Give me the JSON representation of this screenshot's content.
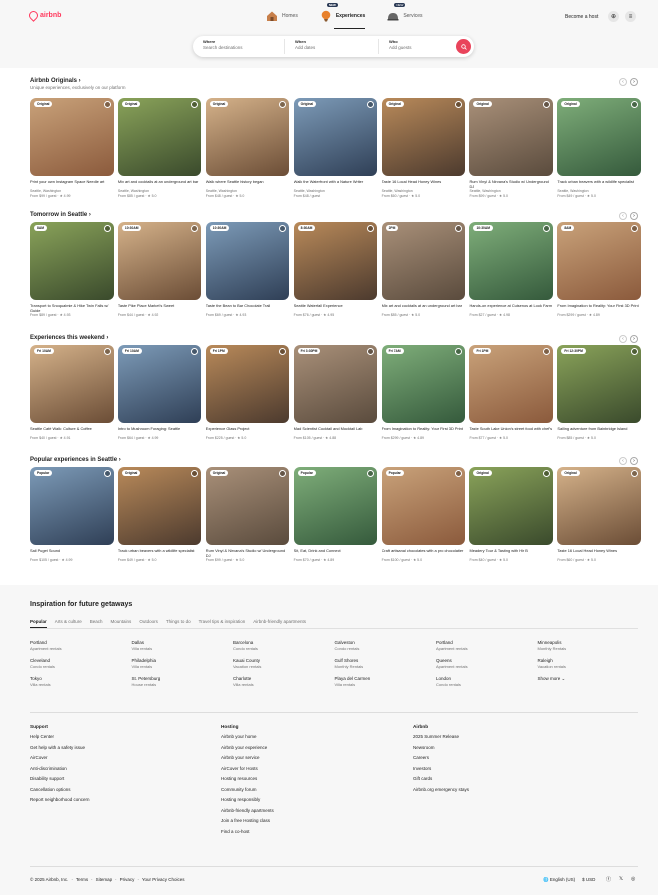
{
  "header": {
    "logo": "airbnb",
    "nav": [
      {
        "label": "Homes",
        "icon": "house-icon"
      },
      {
        "label": "Experiences",
        "icon": "balloon-icon",
        "new": "NEW"
      },
      {
        "label": "Services",
        "icon": "bell-icon",
        "new": "NEW"
      }
    ],
    "host": "Become a host"
  },
  "search": {
    "fields": [
      {
        "label": "Where",
        "placeholder": "Search destinations"
      },
      {
        "label": "When",
        "placeholder": "Add dates"
      },
      {
        "label": "Who",
        "placeholder": "Add guests"
      }
    ]
  },
  "sections": [
    {
      "title": "Airbnb Originals ›",
      "subtitle": "Unique experiences, exclusively on our platform",
      "cards": [
        {
          "badge": "Original",
          "title": "Print your own Instagram Space Needle art",
          "loc": "Seattle, Washington",
          "meta": "From $99 / guest · ★ 4.99"
        },
        {
          "badge": "Original",
          "title": "Mix art and cocktails at an underground art bar",
          "loc": "Seattle, Washington",
          "meta": "From $85 / guest · ★ 5.0"
        },
        {
          "badge": "Original",
          "title": "Walk where Seattle history began",
          "loc": "Seattle, Washington",
          "meta": "From $48 / guest · ★ 5.0"
        },
        {
          "badge": "Original",
          "title": "Walk the Waterfront with a Nature Writer",
          "loc": "Seattle, Washington",
          "meta": "From $48 / guest"
        },
        {
          "badge": "Original",
          "title": "Taste 16 Local Head Honey Wines",
          "loc": "Seattle, Washington",
          "meta": "From $60 / guest · ★ 5.0"
        },
        {
          "badge": "Original",
          "title": "Rum Vinyl & Nirvana's Studio w/ Underground DJ",
          "loc": "Seattle, Washington",
          "meta": "From $99 / guest · ★ 5.0"
        },
        {
          "badge": "Original",
          "title": "Track urban beavers with a wildlife specialist",
          "loc": "Seattle, Washington",
          "meta": "From $49 / guest · ★ 5.0"
        }
      ]
    },
    {
      "title": "Tomorrow in Seattle ›",
      "subtitle": "",
      "cards": [
        {
          "badge": "8AM",
          "title": "Transport to Snoqualmie & Hike Twin Falls w/ Guide",
          "loc": "",
          "meta": "From $89 / guest · ★ 4.93"
        },
        {
          "badge": "10:30AM",
          "title": "Taste Pike Place Market's Sweet",
          "loc": "",
          "meta": "From $44 / guest · ★ 4.92"
        },
        {
          "badge": "10:30AM",
          "title": "Taste the Bean to Bar Chocolate Trail",
          "loc": "",
          "meta": "From $69 / guest · ★ 4.93"
        },
        {
          "badge": "8:30AM",
          "title": "Seattle Waterfall Experience",
          "loc": "",
          "meta": "From $76 / guest · ★ 4.95"
        },
        {
          "badge": "2PM",
          "title": "Mix art and cocktails at an underground art bar",
          "loc": "",
          "meta": "From $85 / guest · ★ 5.0"
        },
        {
          "badge": "10:30AM",
          "title": "Hands-on experience at Cuisenos at Look Farm",
          "loc": "",
          "meta": "From $27 / guest · ★ 4.98"
        },
        {
          "badge": "8AM",
          "title": "From Imagination to Reality: Your First 3D Print",
          "loc": "",
          "meta": "From $299 / guest · ★ 4.89"
        }
      ]
    },
    {
      "title": "Experiences this weekend ›",
      "subtitle": "",
      "cards": [
        {
          "badge": "Fri 10AM",
          "title": "Seattle Café Walk: Culture & Coffee",
          "loc": "",
          "meta": "From $40 / guest · ★ 4.91"
        },
        {
          "badge": "Fri 10AM",
          "title": "Intro to Mushroom Foraging: Seattle",
          "loc": "",
          "meta": "From $64 / guest · ★ 4.99"
        },
        {
          "badge": "Fri 1PM",
          "title": "Experience Glass Project",
          "loc": "",
          "meta": "From $225 / guest · ★ 5.0"
        },
        {
          "badge": "Fri 3:30PM",
          "title": "Mad Scientist Cocktail and Mocktail Lab",
          "loc": "",
          "meta": "From $105 / guest · ★ 4.88"
        },
        {
          "badge": "Fri 7AM",
          "title": "From Imagination to Reality: Your First 3D Print",
          "loc": "",
          "meta": "From $299 / guest · ★ 4.89"
        },
        {
          "badge": "Fri 1PM",
          "title": "Taste South Lake Union's street food with chef's",
          "loc": "",
          "meta": "From $77 / guest · ★ 5.0"
        },
        {
          "badge": "Fri 12:30PM",
          "title": "Sailing adventure from Bainbridge Island",
          "loc": "",
          "meta": "From $85 / guest · ★ 5.0"
        }
      ]
    },
    {
      "title": "Popular experiences in Seattle ›",
      "subtitle": "",
      "cards": [
        {
          "badge": "Popular",
          "title": "Sail Puget Sound",
          "loc": "",
          "meta": "From $105 / guest · ★ 4.99"
        },
        {
          "badge": "Original",
          "title": "Track urban beavers with a wildlife specialist",
          "loc": "",
          "meta": "From $49 / guest · ★ 5.0"
        },
        {
          "badge": "Original",
          "title": "Rum Vinyl & Nirvana's Studio w/ Underground DJ",
          "loc": "",
          "meta": "From $99 / guest · ★ 5.0"
        },
        {
          "badge": "Popular",
          "title": "Sit, Eat, Drink and Connect",
          "loc": "",
          "meta": "From $70 / guest · ★ 4.89"
        },
        {
          "badge": "Popular",
          "title": "Craft artisanal chocolates with a pro chocolatier",
          "loc": "",
          "meta": "From $100 / guest · ★ 5.0"
        },
        {
          "badge": "Original",
          "title": "Meadery Tour & Tasting with Hir B",
          "loc": "",
          "meta": "From $40 / guest · ★ 5.0"
        },
        {
          "badge": "Original",
          "title": "Taste 16 Local Head Honey Wines",
          "loc": "",
          "meta": "From $60 / guest · ★ 5.0"
        }
      ]
    }
  ],
  "inspiration": {
    "title": "Inspiration for future getaways",
    "tabs": [
      "Popular",
      "Arts & culture",
      "Beach",
      "Mountains",
      "Outdoors",
      "Things to do",
      "Travel tips & inspiration",
      "Airbnb-friendly apartments"
    ],
    "destinations": [
      [
        "Portland",
        "Apartment rentals"
      ],
      [
        "Dallas",
        "Villa rentals"
      ],
      [
        "Barcelona",
        "Condo rentals"
      ],
      [
        "Galveston",
        "Condo rentals"
      ],
      [
        "Portland",
        "Apartment rentals"
      ],
      [
        "Minneapolis",
        "Monthly Rentals"
      ],
      [
        "Cleveland",
        "Condo rentals"
      ],
      [
        "Philadelphia",
        "Villa rentals"
      ],
      [
        "Kauai County",
        "Vacation rentals"
      ],
      [
        "Gulf Shores",
        "Monthly Rentals"
      ],
      [
        "Queens",
        "Apartment rentals"
      ],
      [
        "Raleigh",
        "Vacation rentals"
      ],
      [
        "Tokyo",
        "Villa rentals"
      ],
      [
        "St. Petersburg",
        "House rentals"
      ],
      [
        "Charlotte",
        "Villa rentals"
      ],
      [
        "Playa del Carmen",
        "Villa rentals"
      ],
      [
        "London",
        "Condo rentals"
      ],
      [
        "Show more ⌄",
        ""
      ]
    ]
  },
  "footer": {
    "columns": [
      {
        "title": "Support",
        "links": [
          "Help Center",
          "Get help with a safety issue",
          "AirCover",
          "Anti-discrimination",
          "Disability support",
          "Cancellation options",
          "Report neighborhood concern"
        ]
      },
      {
        "title": "Hosting",
        "links": [
          "Airbnb your home",
          "Airbnb your experience",
          "Airbnb your service",
          "AirCover for Hosts",
          "Hosting resources",
          "Community forum",
          "Hosting responsibly",
          "Airbnb-friendly apartments",
          "Join a free Hosting class",
          "Find a co-host"
        ]
      },
      {
        "title": "Airbnb",
        "links": [
          "2025 Summer Release",
          "Newsroom",
          "Careers",
          "Investors",
          "Gift cards",
          "Airbnb.org emergency stays"
        ]
      }
    ],
    "bottom": [
      "© 2025 Airbnb, Inc.",
      "·",
      "Terms",
      "·",
      "Sitemap",
      "·",
      "Privacy",
      "·",
      "Your Privacy Choices"
    ],
    "lang": "English (US)",
    "currency": "$ USD"
  }
}
